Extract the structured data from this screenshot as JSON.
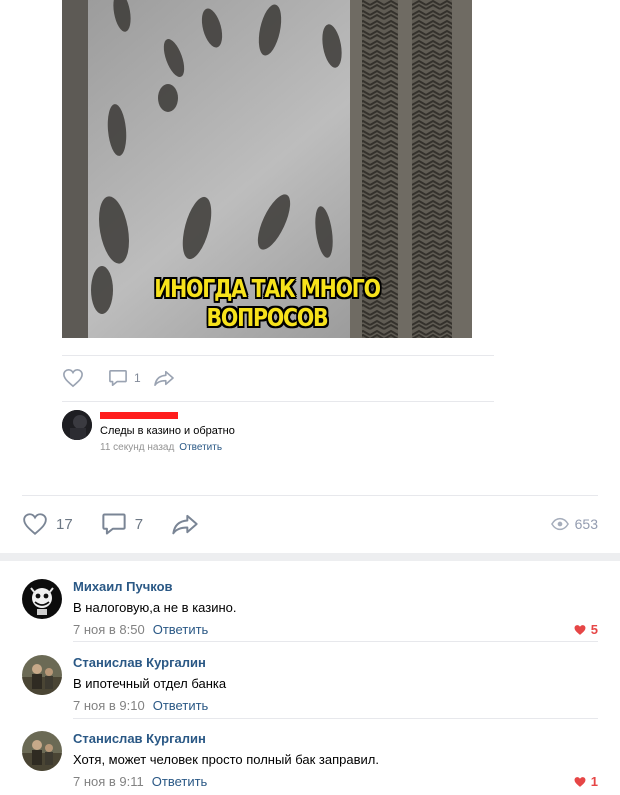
{
  "post": {
    "image_caption": "ИНОГДА ТАК МНОГО ВОПРОСОВ",
    "inner_post": {
      "likes": "",
      "comments": "1",
      "comment": {
        "text": "Следы в казино и обратно",
        "time": "11 секунд назад",
        "reply_label": "Ответить"
      }
    },
    "likes": "17",
    "comments": "7",
    "views": "653"
  },
  "comments": [
    {
      "author": "Михаил Пучков",
      "text": "В налоговую,а не в казино.",
      "time": "7 ноя в 8:50",
      "reply_label": "Ответить",
      "likes": "5"
    },
    {
      "author": "Станислав Кургалин",
      "text": "В ипотечный отдел банка",
      "time": "7 ноя в 9:10",
      "reply_label": "Ответить",
      "likes": ""
    },
    {
      "author": "Станислав Кургалин",
      "text": "Хотя, может человек просто полный бак заправил.",
      "time": "7 ноя в 9:11",
      "reply_label": "Ответить",
      "likes": "1"
    }
  ],
  "icons": {
    "like": "heart-icon",
    "comment": "comment-bubble-icon",
    "share": "share-arrow-icon",
    "views": "eye-icon",
    "liked": "heart-filled-icon"
  },
  "colors": {
    "link": "#2a5885",
    "like_active": "#e64646",
    "caption": "#f7e21b"
  }
}
